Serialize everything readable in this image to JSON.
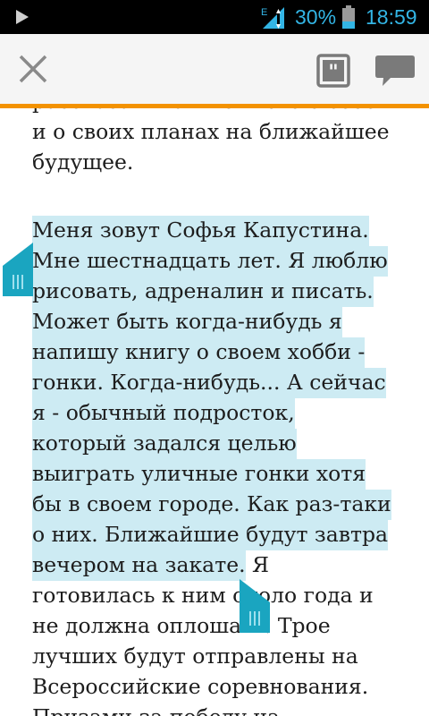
{
  "status_bar": {
    "network": "E",
    "battery_percent": "30%",
    "time": "18:59",
    "accent_color": "#33b5e5"
  },
  "toolbar": {
    "close_icon": "close-icon",
    "quote_icon": "quote-icon",
    "comment_icon": "comment-icon",
    "accent_color": "#f39200"
  },
  "reader": {
    "cut_line": "рассказать вам немного о себе",
    "para1_lines": [
      "и о своих планах на ближайшее",
      "будущее."
    ],
    "para2_selected_lines": [
      "Меня зовут Софья Капустина.",
      "Мне шестнадцать лет. Я люблю",
      "рисовать, адреналин и писать.",
      "Может быть когда-нибудь я",
      "напишу книгу о своем хобби -",
      "гонки. Когда-нибудь... А сейчас",
      "я - обычный подросток,",
      "который задался целью",
      "выиграть уличные гонки хотя",
      "бы в своем городе. Как раз-таки",
      "о них. Ближайшие будут завтра",
      "вечером на закате."
    ],
    "line12_tail": " Я",
    "para2_rest_lines": [
      "готовилась к ним около года и",
      "не должна оплошать. Трое",
      "лучших будут отправлены на",
      "Всероссийские соревнования.",
      "Призами за победу на"
    ],
    "selection_color": "#cdebf3",
    "handle_color": "#1aa5c0"
  }
}
